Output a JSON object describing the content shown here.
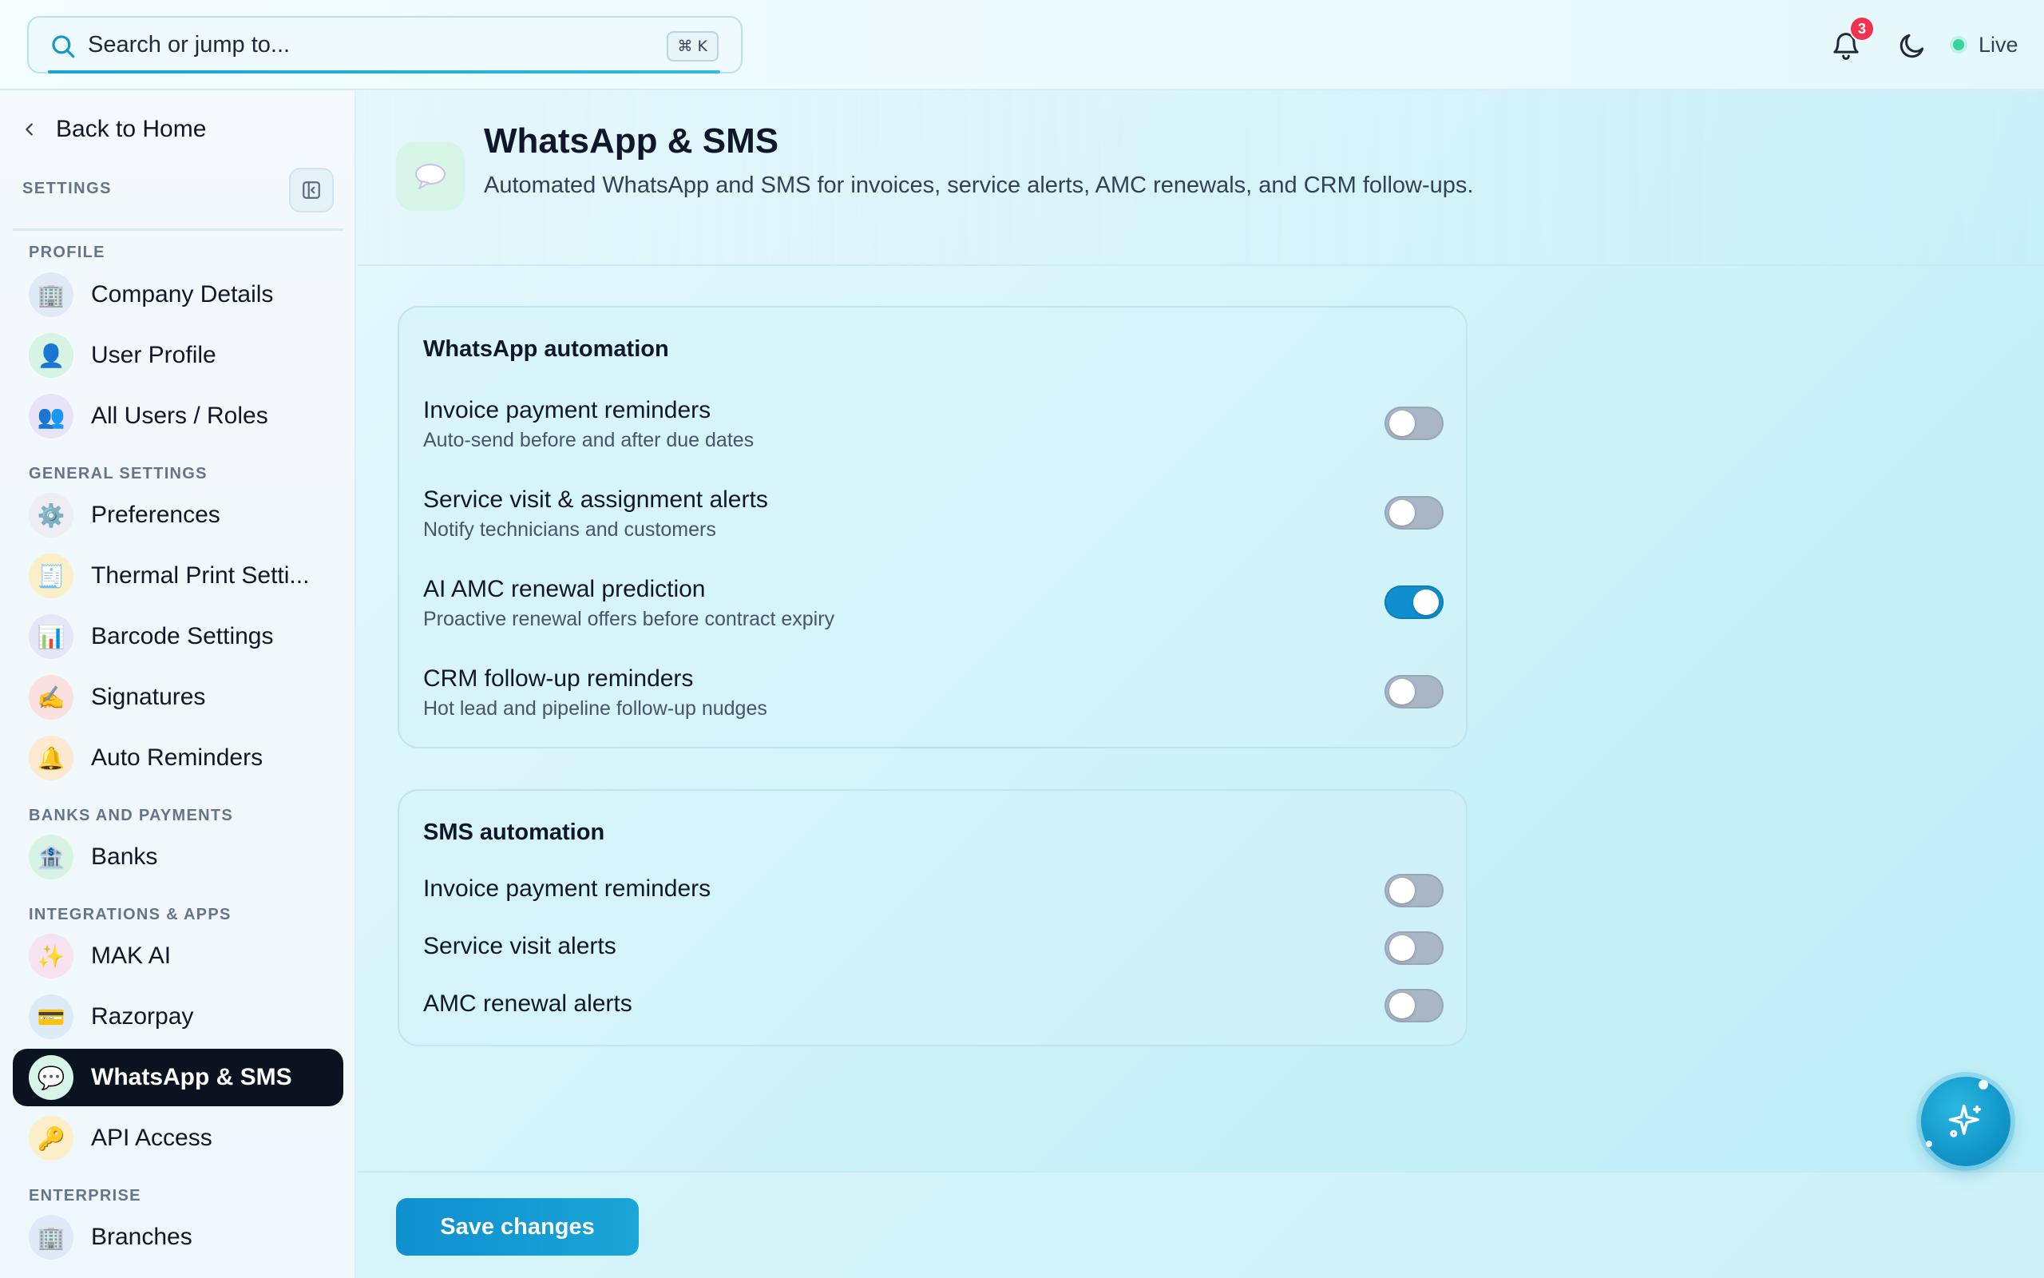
{
  "search": {
    "placeholder": "Search or jump to...",
    "shortcut": "⌘ K"
  },
  "header": {
    "notifications_count": "3",
    "status": "Live"
  },
  "sidebar": {
    "back_label": "Back to Home",
    "title": "SETTINGS",
    "sections": [
      {
        "label": "PROFILE"
      },
      {
        "label": "GENERAL SETTINGS"
      },
      {
        "label": "BANKS AND PAYMENTS"
      },
      {
        "label": "INTEGRATIONS & APPS"
      },
      {
        "label": "ENTERPRISE"
      }
    ],
    "items": [
      {
        "label": "Company Details",
        "icon": "🏢"
      },
      {
        "label": "User Profile",
        "icon": "👤"
      },
      {
        "label": "All Users / Roles",
        "icon": "👥"
      },
      {
        "label": "Preferences",
        "icon": "⚙️"
      },
      {
        "label": "Thermal Print Setti...",
        "icon": "🧾"
      },
      {
        "label": "Barcode Settings",
        "icon": "📊"
      },
      {
        "label": "Signatures",
        "icon": "✍️"
      },
      {
        "label": "Auto Reminders",
        "icon": "🔔"
      },
      {
        "label": "Banks",
        "icon": "🏦"
      },
      {
        "label": "MAK AI",
        "icon": "✨"
      },
      {
        "label": "Razorpay",
        "icon": "💳"
      },
      {
        "label": "WhatsApp & SMS",
        "icon": "💬",
        "active": true
      },
      {
        "label": "API Access",
        "icon": "🔑"
      },
      {
        "label": "Branches",
        "icon": "🏢"
      }
    ]
  },
  "page": {
    "title": "WhatsApp & SMS",
    "subtitle": "Automated WhatsApp and SMS for invoices, service alerts, AMC renewals, and CRM follow-ups."
  },
  "whatsapp": {
    "title": "WhatsApp automation",
    "rows": [
      {
        "label": "Invoice payment reminders",
        "desc": "Auto-send before and after due dates",
        "enabled": false
      },
      {
        "label": "Service visit & assignment alerts",
        "desc": "Notify technicians and customers",
        "enabled": false
      },
      {
        "label": "AI AMC renewal prediction",
        "desc": "Proactive renewal offers before contract expiry",
        "enabled": true
      },
      {
        "label": "CRM follow-up reminders",
        "desc": "Hot lead and pipeline follow-up nudges",
        "enabled": false
      }
    ]
  },
  "sms": {
    "title": "SMS automation",
    "rows": [
      {
        "label": "Invoice payment reminders",
        "enabled": false
      },
      {
        "label": "Service visit alerts",
        "enabled": false
      },
      {
        "label": "AMC renewal alerts",
        "enabled": false
      }
    ]
  },
  "footer": {
    "save_label": "Save changes"
  },
  "colors": {
    "accent": "#0f8fcf",
    "active_nav": "#0b1220",
    "badge": "#f0334f",
    "live": "#34d399"
  }
}
